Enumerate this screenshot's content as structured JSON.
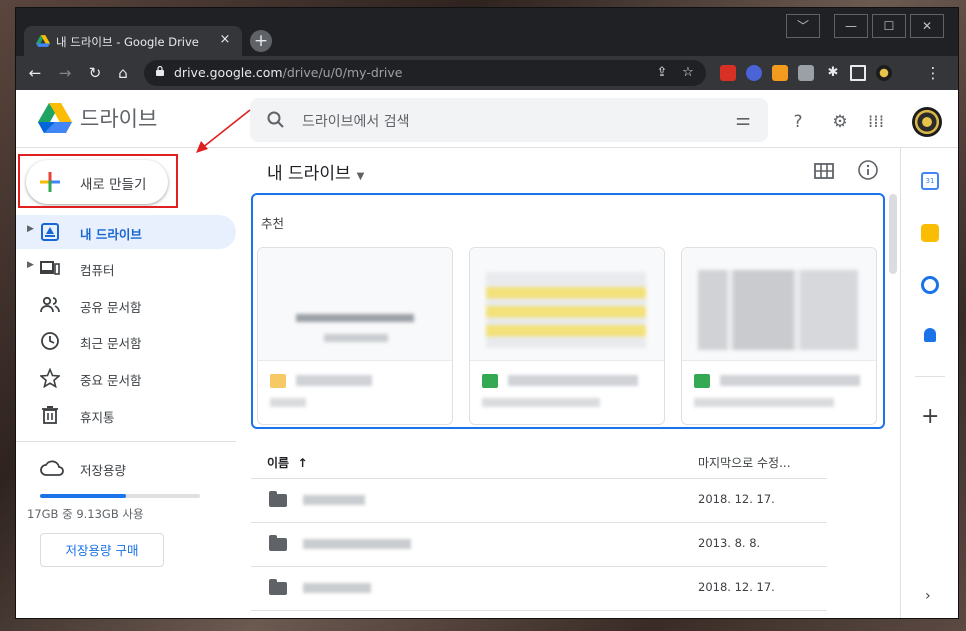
{
  "browser": {
    "tab_title": "내 드라이브 - Google Drive",
    "tab_close": "×",
    "new_tab": "+",
    "url_domain": "drive.google.com",
    "url_path": "/drive/u/0/my-drive",
    "window_controls": [
      "﹀",
      "—",
      "☐",
      "✕"
    ]
  },
  "drive": {
    "brand": "드라이브",
    "search_placeholder": "드라이브에서 검색",
    "new_button": "새로 만들기",
    "nav": [
      {
        "label": "내 드라이브",
        "icon": "my-drive-icon",
        "active": true
      },
      {
        "label": "컴퓨터",
        "icon": "computer-icon",
        "active": false
      },
      {
        "label": "공유 문서함",
        "icon": "shared-icon",
        "active": false
      },
      {
        "label": "최근 문서함",
        "icon": "clock-icon",
        "active": false
      },
      {
        "label": "중요 문서함",
        "icon": "star-icon",
        "active": false
      },
      {
        "label": "휴지통",
        "icon": "trash-icon",
        "active": false
      }
    ],
    "storage": {
      "label": "저장용량",
      "usage_text": "17GB 중 9.13GB 사용",
      "used_fraction": 0.54,
      "buy_button": "저장용량 구매"
    },
    "main": {
      "title": "내 드라이브",
      "recommended_label": "추천",
      "list_header_name": "이름",
      "sort_arrow": "↑",
      "list_header_modified": "마지막으로 수정...",
      "rows": [
        {
          "modified": "2018. 12. 17."
        },
        {
          "modified": "2013. 8. 8."
        },
        {
          "modified": "2018. 12. 17."
        }
      ]
    }
  },
  "colors": {
    "accent": "#1a73e8",
    "active_nav_bg": "#e8f0fe",
    "annotation_red": "#e02020"
  }
}
